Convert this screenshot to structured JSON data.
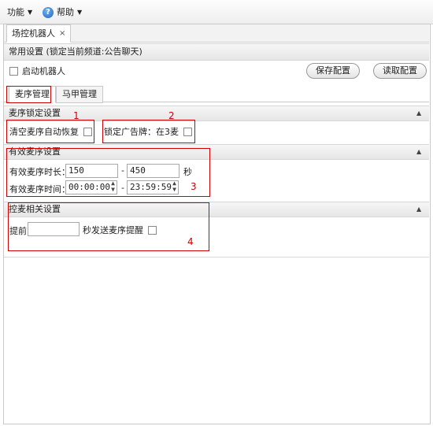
{
  "menubar": {
    "function_label": "功能",
    "help_label": "帮助"
  },
  "tabs": {
    "main_tab_label": "场控机器人",
    "close_glyph": "×"
  },
  "common": {
    "title": "常用设置 (锁定当前频道:公告聊天)",
    "start_robot_label": "启动机器人",
    "save_button": "保存配置",
    "load_button": "读取配置"
  },
  "subtabs": [
    {
      "label": "麦序管理",
      "active": true
    },
    {
      "label": "马甲管理",
      "active": false
    }
  ],
  "lock_section": {
    "title": "麦序锁定设置",
    "clear_label": "清空麦序自动恢复",
    "lock_ad_label": "锁定广告牌：在3麦",
    "annotation_1": "1",
    "annotation_2": "2"
  },
  "valid_section": {
    "title": "有效麦序设置",
    "duration_label": "有效麦序时长：",
    "duration_min": "150",
    "duration_max": "450",
    "duration_unit": "秒",
    "time_label": "有效麦序时间：",
    "time_start": "00:00:00",
    "time_end": "23:59:59",
    "dash": "-",
    "annotation_3": "3"
  },
  "control_section": {
    "title": "控麦相关设置",
    "advance_label": "提前",
    "advance_value": "",
    "send_reminder_label": "秒发送麦序提醒",
    "annotation_4": "4"
  },
  "colors": {
    "annotation_red": "#d00000",
    "help_icon_blue": "#1f64c4"
  }
}
